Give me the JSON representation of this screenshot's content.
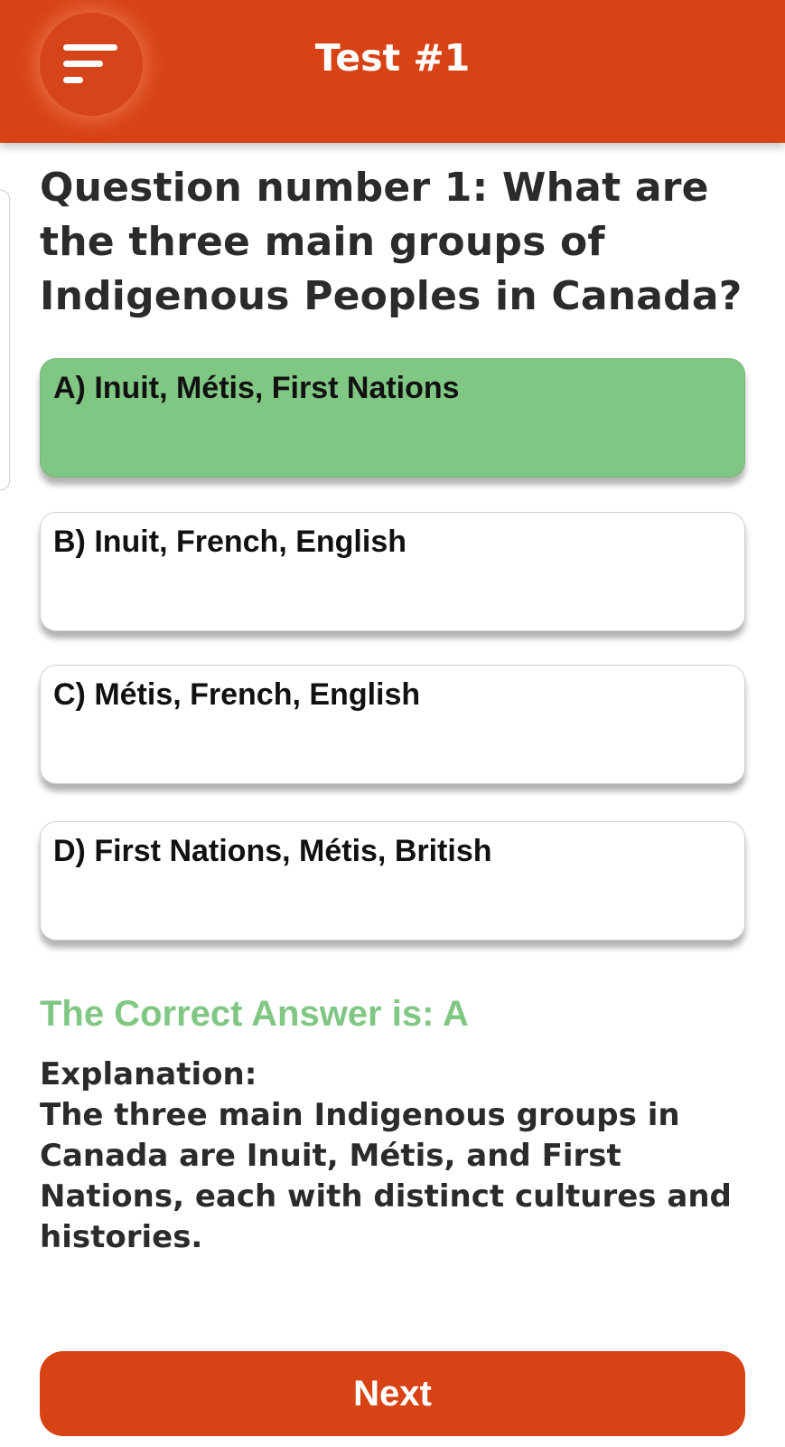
{
  "header": {
    "title": "Test #1",
    "menu_icon": "menu-icon",
    "background_color": "#d84315"
  },
  "question": {
    "text": "Question number 1: What are the three main groups of Indigenous Peoples in Canada?"
  },
  "options": [
    {
      "label": "A) Inuit, Métis, First Nations",
      "state": "correct"
    },
    {
      "label": "B) Inuit, French, English",
      "state": "default"
    },
    {
      "label": "C) Métis, French, English",
      "state": "default"
    },
    {
      "label": "D) First Nations, Métis, British",
      "state": "default"
    }
  ],
  "result": {
    "text": "The Correct Answer is: A",
    "color": "#81c784"
  },
  "explanation": {
    "heading": "Explanation:",
    "text": "The three main Indigenous groups in Canada are Inuit, Métis, and First Nations, each with distinct cultures and histories."
  },
  "footer": {
    "next_label": "Next"
  }
}
